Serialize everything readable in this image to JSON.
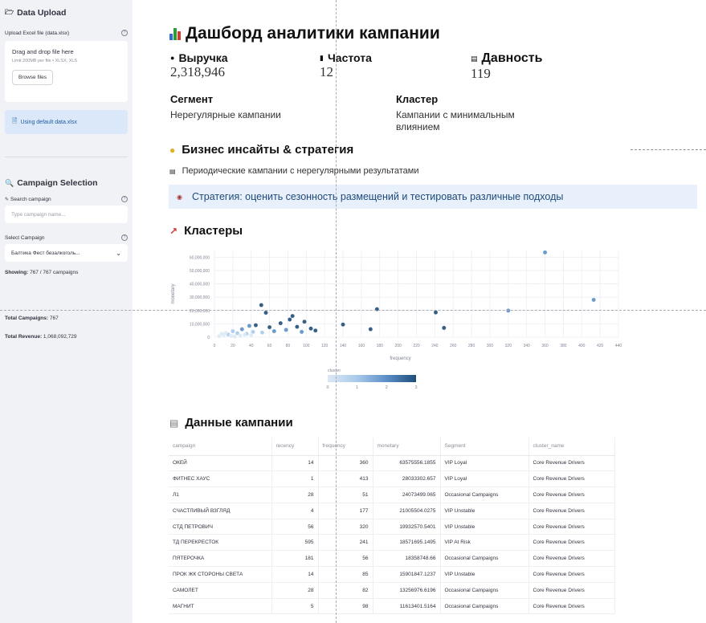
{
  "sidebar": {
    "data_upload": {
      "heading": "Data Upload",
      "upload_label": "Upload Excel file (data.xlsx)",
      "dropzone_title": "Drag and drop file here",
      "dropzone_sub": "Limit 200MB per file • XLSX, XLS",
      "browse_label": "Browse files",
      "info_text": "Using default data.xlsx"
    },
    "campaign_selection": {
      "heading": "Campaign Selection",
      "search_label": "Search campaign",
      "search_placeholder": "Type campaign name...",
      "select_label": "Select Campaign",
      "select_value": "Балтика Фест безалкоголь...",
      "showing_label": "Showing:",
      "showing_value": "767 / 767 campaigns"
    },
    "totals": {
      "campaigns_label": "Total Campaigns:",
      "campaigns_value": "767",
      "revenue_label": "Total Revenue:",
      "revenue_value": "1,068,092,729"
    }
  },
  "main": {
    "title": "Дашборд аналитики кампании",
    "metrics": [
      {
        "label": "Выручка",
        "value": "2,318,946"
      },
      {
        "label": "Частота",
        "value": "12"
      },
      {
        "label": "Давность",
        "value": "119"
      }
    ],
    "segment": {
      "label": "Сегмент",
      "value": "Нерегулярные кампании"
    },
    "cluster": {
      "label": "Кластер",
      "value_line1": "Кампании с минимальным",
      "value_line2": "влиянием"
    },
    "insights": {
      "heading": "Бизнес инсайты & стратегия",
      "text": "Периодические кампании с нерегулярными результатами",
      "strategy": "Стратегия: оценить сезонность размещений и тестировать различные подходы"
    },
    "clusters_heading": "Кластеры",
    "data_heading": "Данные кампании"
  },
  "colors": {
    "sidebar_bg": "#f0f2f6",
    "info_bg": "#dbe8fa",
    "strategy_bg": "#e8f0fb",
    "point_dark": "#1f4e79",
    "point_light": "#c8dcf0"
  },
  "chart_data": {
    "type": "scatter",
    "xlabel": "frequency",
    "ylabel": "monetary",
    "xlim": [
      0,
      440
    ],
    "ylim": [
      0,
      65000000
    ],
    "x_ticks": [
      0,
      20,
      40,
      60,
      80,
      100,
      120,
      140,
      160,
      180,
      200,
      220,
      240,
      260,
      280,
      300,
      320,
      340,
      360,
      380,
      400,
      420,
      440
    ],
    "y_ticks": [
      0,
      10000000,
      20000000,
      30000000,
      40000000,
      50000000,
      60000000
    ],
    "y_tick_labels": [
      "0",
      "10,000,000",
      "20,000,000",
      "30,000,000",
      "40,000,000",
      "50,000,000",
      "60,000,000"
    ],
    "colorbar": {
      "label": "cluster",
      "ticks": [
        "0",
        "1",
        "2",
        "3"
      ]
    },
    "grid": true,
    "points": [
      {
        "x": 360,
        "y": 63575556,
        "c": 2
      },
      {
        "x": 413,
        "y": 28033302,
        "c": 2
      },
      {
        "x": 320,
        "y": 19932571,
        "c": 2
      },
      {
        "x": 241,
        "y": 18571695,
        "c": 3
      },
      {
        "x": 177,
        "y": 21005504,
        "c": 3
      },
      {
        "x": 51,
        "y": 24073499,
        "c": 3
      },
      {
        "x": 85,
        "y": 15901847,
        "c": 3
      },
      {
        "x": 82,
        "y": 13256976,
        "c": 3
      },
      {
        "x": 98,
        "y": 11613401,
        "c": 3
      },
      {
        "x": 56,
        "y": 18358749,
        "c": 3
      },
      {
        "x": 250,
        "y": 7000000,
        "c": 3
      },
      {
        "x": 140,
        "y": 9500000,
        "c": 3
      },
      {
        "x": 170,
        "y": 6000000,
        "c": 3
      },
      {
        "x": 45,
        "y": 9000000,
        "c": 3
      },
      {
        "x": 60,
        "y": 7500000,
        "c": 3
      },
      {
        "x": 72,
        "y": 10500000,
        "c": 3
      },
      {
        "x": 90,
        "y": 7800000,
        "c": 3
      },
      {
        "x": 105,
        "y": 6500000,
        "c": 3
      },
      {
        "x": 110,
        "y": 5000000,
        "c": 3
      },
      {
        "x": 30,
        "y": 6000000,
        "c": 2
      },
      {
        "x": 38,
        "y": 8500000,
        "c": 2
      },
      {
        "x": 65,
        "y": 4500000,
        "c": 2
      },
      {
        "x": 78,
        "y": 5500000,
        "c": 2
      },
      {
        "x": 95,
        "y": 4000000,
        "c": 2
      },
      {
        "x": 52,
        "y": 3500000,
        "c": 1
      },
      {
        "x": 25,
        "y": 3000000,
        "c": 1
      },
      {
        "x": 35,
        "y": 2500000,
        "c": 1
      },
      {
        "x": 42,
        "y": 4000000,
        "c": 1
      },
      {
        "x": 15,
        "y": 2000000,
        "c": 1
      },
      {
        "x": 20,
        "y": 4500000,
        "c": 1
      },
      {
        "x": 10,
        "y": 1500000,
        "c": 0
      },
      {
        "x": 5,
        "y": 800000,
        "c": 0
      },
      {
        "x": 18,
        "y": 1000000,
        "c": 0
      },
      {
        "x": 28,
        "y": 1200000,
        "c": 0
      },
      {
        "x": 8,
        "y": 2500000,
        "c": 0
      },
      {
        "x": 33,
        "y": 1800000,
        "c": 0
      },
      {
        "x": 22,
        "y": 600000,
        "c": 0
      },
      {
        "x": 12,
        "y": 3200000,
        "c": 0
      },
      {
        "x": 40,
        "y": 1500000,
        "c": 0
      }
    ]
  },
  "table": {
    "columns": [
      "campaign",
      "recency",
      "frequency",
      "monetary",
      "Segment",
      "cluster_name"
    ],
    "rows": [
      [
        "ОКЕЙ",
        "14",
        "360",
        "63575556.1855",
        "VIP Loyal",
        "Core Revenue Drivers"
      ],
      [
        "ФИТНЕС ХАУС",
        "1",
        "413",
        "28033302.657",
        "VIP Loyal",
        "Core Revenue Drivers"
      ],
      [
        "Л1",
        "28",
        "51",
        "24073499.065",
        "Occasional Campaigns",
        "Core Revenue Drivers"
      ],
      [
        "СЧАСТЛИВЫЙ ВЗГЛЯД",
        "4",
        "177",
        "21005504.0275",
        "VIP Unstable",
        "Core Revenue Drivers"
      ],
      [
        "СТД ПЕТРОВИЧ",
        "56",
        "320",
        "19932570.5401",
        "VIP Unstable",
        "Core Revenue Drivers"
      ],
      [
        "ТД ПЕРЕКРЕСТОК",
        "595",
        "241",
        "18571695.1495",
        "VIP At Risk",
        "Core Revenue Drivers"
      ],
      [
        "ПЯТЕРОЧКА",
        "181",
        "56",
        "18358748.66",
        "Occasional Campaigns",
        "Core Revenue Drivers"
      ],
      [
        "ПРОК ЖК СТОРОНЫ СВЕТА",
        "14",
        "85",
        "15901847.1237",
        "VIP Unstable",
        "Core Revenue Drivers"
      ],
      [
        "САМОЛЕТ",
        "28",
        "82",
        "13256976.6196",
        "Occasional Campaigns",
        "Core Revenue Drivers"
      ],
      [
        "МАГНИТ",
        "5",
        "98",
        "11613401.5164",
        "Occasional Campaigns",
        "Core Revenue Drivers"
      ]
    ]
  }
}
